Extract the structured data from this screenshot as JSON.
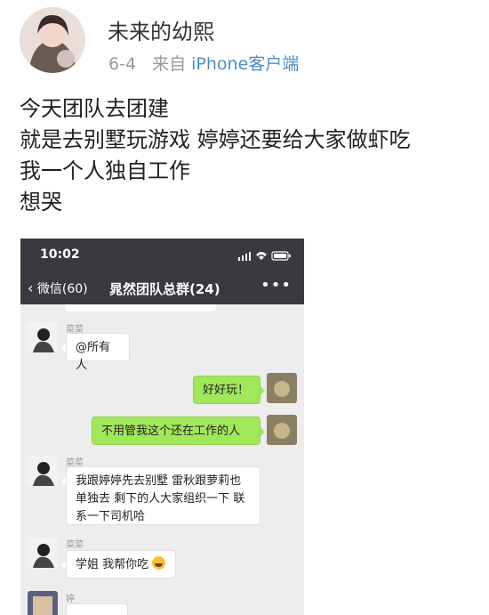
{
  "post": {
    "user_name": "未来的幼熙",
    "date": "6-4",
    "source_prefix": "来自",
    "client": "iPhone客户端",
    "lines": [
      "今天团队去团建",
      "就是去别墅玩游戏 婷婷还要给大家做虾吃",
      "我一个人独自工作",
      "想哭"
    ]
  },
  "chat": {
    "time": "10:02",
    "back_label": "微信(60)",
    "title": "晁然团队总群(24)",
    "more": "•••",
    "messages": [
      {
        "sender": "菜菜",
        "text": "@所有人"
      },
      {
        "sender": "",
        "text": "好好玩！"
      },
      {
        "sender": "",
        "text": "不用管我这个还在工作的人"
      },
      {
        "sender": "菜菜",
        "text": "我跟婷婷先去别墅 雷秋跟萝莉也单独去 剩下的人大家组织一下 联系一下司机哈"
      },
      {
        "sender": "菜菜",
        "text": "学姐 我帮你吃"
      },
      {
        "sender": "婷",
        "text": ""
      }
    ]
  }
}
